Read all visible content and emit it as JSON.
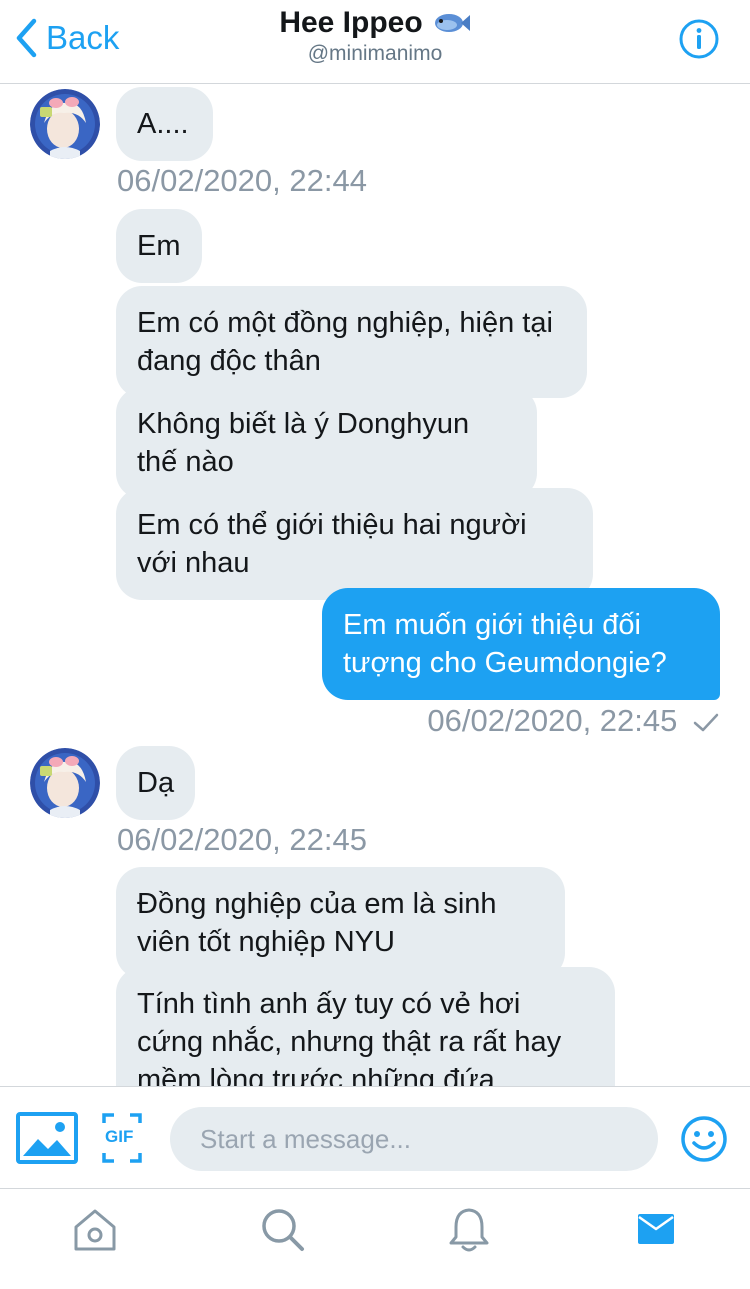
{
  "header": {
    "back_label": "Back",
    "title": "Hee Ippeo",
    "handle": "@minimanimo",
    "title_icon": "fish-icon",
    "info_icon": "info-icon"
  },
  "messages": [
    {
      "side": "in",
      "text": "A...."
    },
    {
      "timestamp": "06/02/2020, 22:44"
    },
    {
      "side": "in",
      "text": "Em"
    },
    {
      "side": "in",
      "text": "Em có một đồng nghiệp, hiện tại đang độc thân"
    },
    {
      "side": "in",
      "text": "Không biết là ý Donghyun thế nào"
    },
    {
      "side": "in",
      "text": "Em có thể giới thiệu hai người với nhau"
    },
    {
      "side": "out",
      "text": "Em muốn giới thiệu đối tượng cho Geumdongie?"
    },
    {
      "timestamp": "06/02/2020, 22:45",
      "status": "sent"
    },
    {
      "side": "in",
      "text": "Dạ"
    },
    {
      "timestamp": "06/02/2020, 22:45"
    },
    {
      "side": "in",
      "text": "Đồng nghiệp của em là sinh viên tốt nghiệp NYU"
    },
    {
      "side": "in",
      "text": "Tính tình anh ấy tuy có vẻ hơi cứng nhắc, nhưng thật ra rất hay mềm lòng trước những đứa"
    }
  ],
  "composer": {
    "placeholder": "Start a message...",
    "media_icon": "image-icon",
    "gif_label": "GIF",
    "emoji_icon": "smiley-icon"
  },
  "tabs": [
    {
      "icon": "home-icon"
    },
    {
      "icon": "search-icon"
    },
    {
      "icon": "bell-icon"
    },
    {
      "icon": "mail-icon",
      "active": true
    }
  ],
  "colors": {
    "accent": "#1da1f2",
    "bubble_in": "#e6ecf0",
    "timestamp": "#8b98a5"
  }
}
